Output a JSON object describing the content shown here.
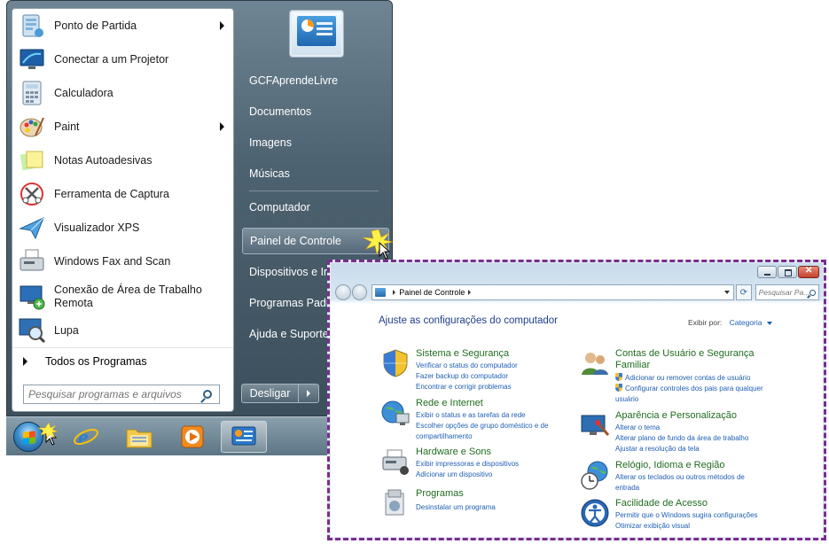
{
  "start_menu": {
    "programs": [
      {
        "label": "Ponto de Partida",
        "icon": "getting-started-icon",
        "has_submenu": true
      },
      {
        "label": "Conectar a um Projetor",
        "icon": "projector-icon",
        "has_submenu": false
      },
      {
        "label": "Calculadora",
        "icon": "calculator-icon",
        "has_submenu": false
      },
      {
        "label": "Paint",
        "icon": "paint-palette-icon",
        "has_submenu": true
      },
      {
        "label": "Notas Autoadesivas",
        "icon": "sticky-notes-icon",
        "has_submenu": false
      },
      {
        "label": "Ferramenta de Captura",
        "icon": "snipping-tool-icon",
        "has_submenu": false
      },
      {
        "label": "Visualizador XPS",
        "icon": "xps-viewer-icon",
        "has_submenu": false
      },
      {
        "label": "Windows Fax and Scan",
        "icon": "fax-scanner-icon",
        "has_submenu": false
      },
      {
        "label": "Conexão de Área de Trabalho Remota",
        "icon": "remote-desktop-icon",
        "has_submenu": false
      },
      {
        "label": "Lupa",
        "icon": "magnifier-icon",
        "has_submenu": false
      }
    ],
    "all_programs": "Todos os Programas",
    "search_placeholder": "Pesquisar programas e arquivos",
    "right_links": [
      {
        "label": "GCFAprendeLivre"
      },
      {
        "label": "Documentos"
      },
      {
        "label": "Imagens"
      },
      {
        "label": "Músicas"
      },
      {
        "label": "Computador"
      },
      {
        "label": "Painel de Controle",
        "active": true
      },
      {
        "label": "Dispositivos e Impressoras"
      },
      {
        "label": "Programas Padrão"
      },
      {
        "label": "Ajuda e Suporte"
      }
    ],
    "shutdown_label": "Desligar"
  },
  "taskbar": {
    "items": [
      "start-orb-icon",
      "internet-explorer-icon",
      "windows-explorer-icon",
      "media-player-icon",
      "control-panel-icon"
    ]
  },
  "control_panel": {
    "breadcrumb": "Painel de Controle",
    "search_placeholder": "Pesquisar Pa...",
    "heading": "Ajuste as configurações do computador",
    "view_by_label": "Exibir por:",
    "view_by_value": "Categoria",
    "categories": [
      {
        "title": "Sistema e Segurança",
        "icon": "system-security-icon",
        "links": [
          "Verificar o status do computador",
          "Fazer backup do computador",
          "Encontrar e corrigir problemas"
        ]
      },
      {
        "title": "Rede e Internet",
        "icon": "network-internet-icon",
        "links": [
          "Exibir o status e as tarefas da rede",
          "Escolher opções de grupo doméstico e de compartilhamento"
        ]
      },
      {
        "title": "Hardware e Sons",
        "icon": "hardware-sound-icon",
        "links": [
          "Exibir impressoras e dispositivos",
          "Adicionar um dispositivo"
        ]
      },
      {
        "title": "Programas",
        "icon": "programs-icon",
        "links": [
          "Desinstalar um programa"
        ]
      },
      {
        "title": "Contas de Usuário e Segurança Familiar",
        "icon": "user-accounts-icon",
        "links": [
          "Adicionar ou remover contas de usuário",
          "Configurar controles dos pais para qualquer usuário"
        ]
      },
      {
        "title": "Aparência e Personalização",
        "icon": "appearance-icon",
        "links": [
          "Alterar o tema",
          "Alterar plano de fundo da área de trabalho",
          "Ajustar a resolução da tela"
        ]
      },
      {
        "title": "Relógio, Idioma e Região",
        "icon": "clock-region-icon",
        "links": [
          "Alterar os teclados ou outros métodos de entrada"
        ]
      },
      {
        "title": "Facilidade de Acesso",
        "icon": "ease-of-access-icon",
        "links": [
          "Permitir que o Windows sugira configurações",
          "Otimizar exibição visual"
        ]
      }
    ]
  },
  "colors": {
    "start_menu_right": "#4d6270",
    "link_blue": "#1f5fb4",
    "category_green": "#1f6d1f",
    "highlight_border": "#7a2d8e"
  }
}
